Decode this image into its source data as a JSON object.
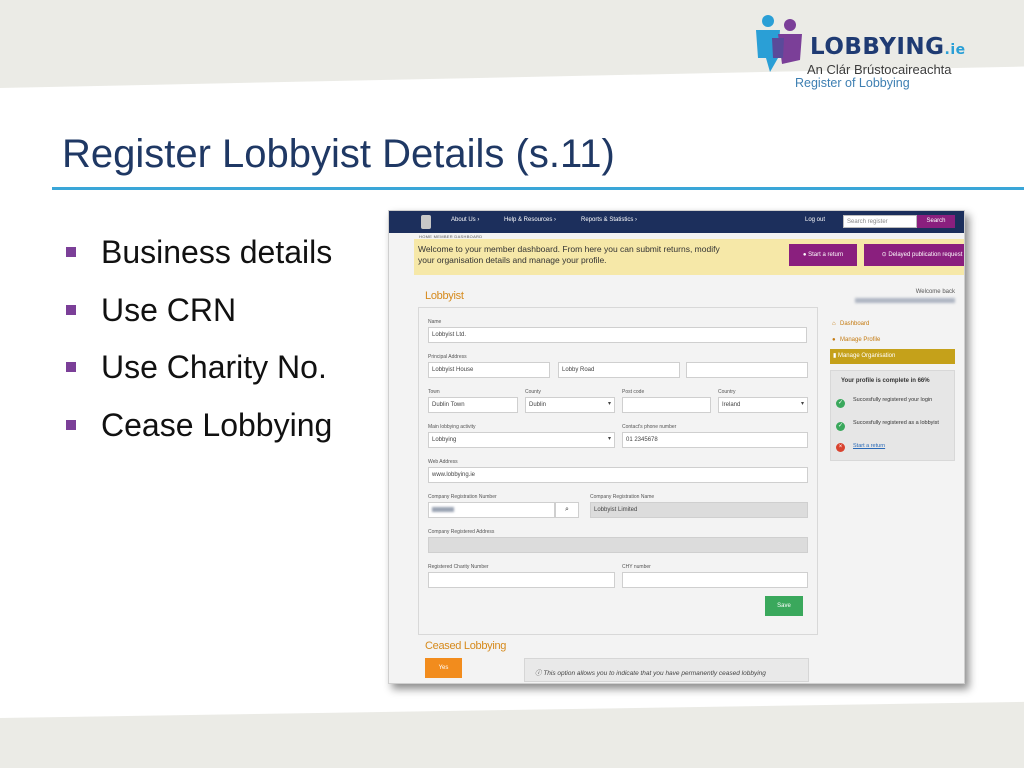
{
  "logo": {
    "name": "LOBBYING",
    "tld": ".ie",
    "subtitle_ga": "An Clár Brústocaireachta",
    "subtitle_en": "Register of Lobbying"
  },
  "slide": {
    "title": "Register Lobbyist Details (s.11)",
    "bullets": [
      "Business details",
      "Use CRN",
      "Use Charity No.",
      "Cease Lobbying"
    ]
  },
  "screenshot": {
    "nav": {
      "items": [
        "About Us",
        "Help & Resources",
        "Reports & Statistics"
      ],
      "logout": "Log out",
      "search_placeholder": "Search register",
      "search_button": "Search"
    },
    "breadcrumb": "HOME   MEMBER DASHBOARD",
    "welcome_message": "Welcome to your member dashboard. From here you can submit returns, modify your organisation details and manage your profile.",
    "start_return": "Start a return",
    "delayed_request": "Delayed publication request",
    "section_title": "Lobbyist",
    "form": {
      "name_label": "Name",
      "name_value": "Lobbyist Ltd.",
      "address_label": "Principal Address",
      "address1": "Lobbyist House",
      "address2": "Lobby Road",
      "address3": "",
      "town_label": "Town",
      "town_value": "Dublin Town",
      "county_label": "County",
      "county_value": "Dublin",
      "postcode_label": "Post code",
      "postcode_value": "",
      "country_label": "Country",
      "country_value": "Ireland",
      "activity_label": "Main lobbying activity",
      "activity_value": "Lobbying",
      "phone_label": "Contact's phone number",
      "phone_value": "01 2345678",
      "web_label": "Web Address",
      "web_value": "www.lobbying.ie",
      "crn_label": "Company Registration Number",
      "crn_name_label": "Company Registration Name",
      "crn_name_value": "Lobbyist Limited",
      "reg_address_label": "Company Registered Address",
      "charity_label": "Registered Charity Number",
      "chy_label": "CHY number",
      "save": "Save"
    },
    "ceased": {
      "title": "Ceased Lobbying",
      "yes": "Yes",
      "notice": "This option allows you to indicate that you have permanently ceased lobbying"
    },
    "sidebar": {
      "welcome_back": "Welcome back",
      "links": [
        "Dashboard",
        "Manage Profile"
      ],
      "active": "Manage Organisation",
      "profile_title": "Your profile is complete in 66%",
      "profile_rows": [
        "Succesfully registered your login",
        "Succesfully registered as a lobbyist",
        "Start a return"
      ]
    }
  },
  "colors": {
    "title": "#1f3864",
    "accent_rule": "#3aa6d8",
    "bullet": "#7b3f98",
    "nav": "#1c2f5c",
    "purple_button": "#8a1f7e",
    "orange_heading": "#d68a1c",
    "save_green": "#3aa85c",
    "yes_orange": "#f28c1d"
  }
}
